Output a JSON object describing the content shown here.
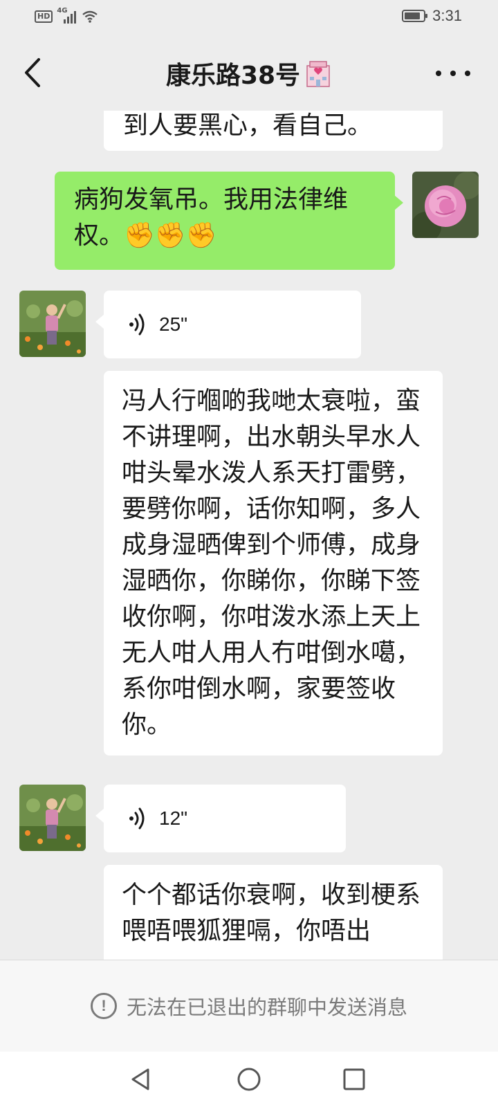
{
  "status_bar": {
    "hd_label": "HD",
    "network_label": "4G",
    "time": "3:31",
    "battery_level": 0.85
  },
  "header": {
    "title": "康乐路38号",
    "title_icon": "hospital-emoji-icon",
    "back_icon": "chevron-left-icon",
    "more_icon": "more-dots-icon"
  },
  "messages": [
    {
      "type": "text",
      "side": "left",
      "text": "到人要黑心，看自己。"
    },
    {
      "type": "text",
      "side": "right",
      "text": "病狗发氧吊。我用法律维权。✊✊✊",
      "avatar": "pink-rose-avatar"
    },
    {
      "type": "voice",
      "side": "left",
      "duration": "25\"",
      "avatar": "woman-in-garden-avatar"
    },
    {
      "type": "text",
      "side": "left",
      "text": "冯人行嗰啲我哋太衰啦，蛮不讲理啊，出水朝头早水人咁头晕水泼人系天打雷劈，要劈你啊，话你知啊，多人成身湿晒俾到个师傅，成身湿晒你，你睇你，你睇下签收你啊，你咁泼水添上天上无人咁人用人冇咁倒水噶，系你咁倒水啊，家要签收你。"
    },
    {
      "type": "voice",
      "side": "left",
      "duration": "12\"",
      "avatar": "woman-in-garden-avatar"
    },
    {
      "type": "text",
      "side": "left",
      "text": "个个都话你衰啊，收到梗系喂唔喂狐狸嗝，你唔出"
    }
  ],
  "notice": {
    "icon": "info-circle-icon",
    "text": "无法在已退出的群聊中发送消息"
  },
  "system_nav": {
    "back_icon": "triangle-back-icon",
    "home_icon": "circle-home-icon",
    "recents_icon": "square-recents-icon"
  },
  "colors": {
    "background": "#ededed",
    "self_bubble": "#95ec69",
    "other_bubble": "#ffffff"
  }
}
